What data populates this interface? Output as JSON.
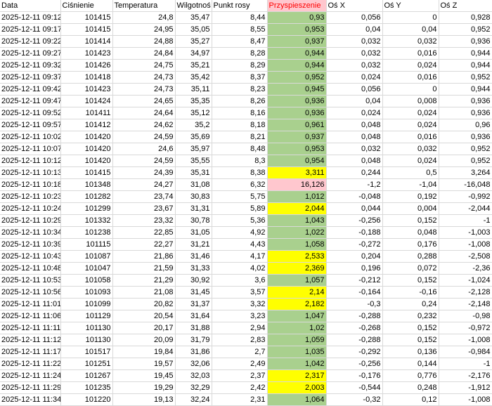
{
  "headers": [
    "Data",
    "Ciśnienie",
    "Temperatura",
    "Wilgotność",
    "Punkt rosy",
    "Przyspieszenie",
    "Oś X",
    "Oś Y",
    "Oś Z"
  ],
  "headers_display": [
    "Data",
    "Ciśnienie",
    "Temperatura",
    "Wilgotnoś",
    "Punkt rosy",
    "Przyspieszenie",
    "Oś X",
    "Oś Y",
    "Oś Z"
  ],
  "colors": {
    "green": "#a9d08e",
    "yellow": "#ffff00",
    "pink": "#ffc7ce",
    "header_accent": "#ff0000"
  },
  "rows": [
    {
      "cells": [
        "2025-12-11 09:12",
        "101415",
        "24,8",
        "35,47",
        "8,44",
        "0,93",
        "0,056",
        "0",
        "0,928"
      ],
      "hl": "green"
    },
    {
      "cells": [
        "2025-12-11 09:17",
        "101415",
        "24,95",
        "35,05",
        "8,55",
        "0,953",
        "0,04",
        "0,04",
        "0,952"
      ],
      "hl": "green"
    },
    {
      "cells": [
        "2025-12-11 09:22",
        "101414",
        "24,88",
        "35,27",
        "8,47",
        "0,937",
        "0,032",
        "0,032",
        "0,936"
      ],
      "hl": "green"
    },
    {
      "cells": [
        "2025-12-11 09:27",
        "101423",
        "24,84",
        "34,97",
        "8,28",
        "0,944",
        "0,032",
        "0,016",
        "0,944"
      ],
      "hl": "green"
    },
    {
      "cells": [
        "2025-12-11 09:32",
        "101426",
        "24,75",
        "35,21",
        "8,29",
        "0,944",
        "0,032",
        "0,024",
        "0,944"
      ],
      "hl": "green"
    },
    {
      "cells": [
        "2025-12-11 09:37",
        "101418",
        "24,73",
        "35,42",
        "8,37",
        "0,952",
        "0,024",
        "0,016",
        "0,952"
      ],
      "hl": "green"
    },
    {
      "cells": [
        "2025-12-11 09:42",
        "101423",
        "24,73",
        "35,11",
        "8,23",
        "0,945",
        "0,056",
        "0",
        "0,944"
      ],
      "hl": "green"
    },
    {
      "cells": [
        "2025-12-11 09:47",
        "101424",
        "24,65",
        "35,35",
        "8,26",
        "0,936",
        "0,04",
        "0,008",
        "0,936"
      ],
      "hl": "green"
    },
    {
      "cells": [
        "2025-12-11 09:52",
        "101411",
        "24,64",
        "35,12",
        "8,16",
        "0,936",
        "0,024",
        "0,024",
        "0,936"
      ],
      "hl": "green"
    },
    {
      "cells": [
        "2025-12-11 09:57",
        "101412",
        "24,62",
        "35,2",
        "8,18",
        "0,961",
        "0,048",
        "0,024",
        "0,96"
      ],
      "hl": "green"
    },
    {
      "cells": [
        "2025-12-11 10:02",
        "101420",
        "24,59",
        "35,69",
        "8,21",
        "0,937",
        "0,048",
        "0,016",
        "0,936"
      ],
      "hl": "green"
    },
    {
      "cells": [
        "2025-12-11 10:07",
        "101420",
        "24,6",
        "35,97",
        "8,48",
        "0,953",
        "0,032",
        "0,032",
        "0,952"
      ],
      "hl": "green"
    },
    {
      "cells": [
        "2025-12-11 10:12",
        "101420",
        "24,59",
        "35,55",
        "8,3",
        "0,954",
        "0,048",
        "0,024",
        "0,952"
      ],
      "hl": "green"
    },
    {
      "cells": [
        "2025-12-11 10:13",
        "101415",
        "24,39",
        "35,31",
        "8,38",
        "3,311",
        "0,244",
        "0,5",
        "3,264"
      ],
      "hl": "yellow"
    },
    {
      "cells": [
        "2025-12-11 10:18",
        "101348",
        "24,27",
        "31,08",
        "6,32",
        "16,126",
        "-1,2",
        "-1,04",
        "-16,048"
      ],
      "hl": "pink"
    },
    {
      "cells": [
        "2025-12-11 10:23",
        "101282",
        "23,74",
        "30,83",
        "5,75",
        "1,012",
        "-0,048",
        "0,192",
        "-0,992"
      ],
      "hl": "green"
    },
    {
      "cells": [
        "2025-12-11 10:24",
        "101299",
        "23,67",
        "31,31",
        "5,89",
        "2,044",
        "0,044",
        "0,004",
        "-2,044"
      ],
      "hl": "yellow"
    },
    {
      "cells": [
        "2025-12-11 10:29",
        "101332",
        "23,32",
        "30,78",
        "5,36",
        "1,043",
        "-0,256",
        "0,152",
        "-1"
      ],
      "hl": "green"
    },
    {
      "cells": [
        "2025-12-11 10:34",
        "101238",
        "22,85",
        "31,05",
        "4,92",
        "1,022",
        "-0,188",
        "0,048",
        "-1,003"
      ],
      "hl": "green"
    },
    {
      "cells": [
        "2025-12-11 10:39",
        "101115",
        "22,27",
        "31,21",
        "4,43",
        "1,058",
        "-0,272",
        "0,176",
        "-1,008"
      ],
      "hl": "green"
    },
    {
      "cells": [
        "2025-12-11 10:43",
        "101087",
        "21,86",
        "31,46",
        "4,17",
        "2,533",
        "0,204",
        "0,288",
        "-2,508"
      ],
      "hl": "yellow"
    },
    {
      "cells": [
        "2025-12-11 10:48",
        "101047",
        "21,59",
        "31,33",
        "4,02",
        "2,369",
        "0,196",
        "0,072",
        "-2,36"
      ],
      "hl": "yellow"
    },
    {
      "cells": [
        "2025-12-11 10:53",
        "101058",
        "21,29",
        "30,92",
        "3,6",
        "1,057",
        "-0,212",
        "0,152",
        "-1,024"
      ],
      "hl": "green"
    },
    {
      "cells": [
        "2025-12-11 10:56",
        "101093",
        "21,08",
        "31,45",
        "3,57",
        "2,14",
        "-0,164",
        "-0,16",
        "-2,128"
      ],
      "hl": "yellow"
    },
    {
      "cells": [
        "2025-12-11 11:01",
        "101099",
        "20,82",
        "31,37",
        "3,32",
        "2,182",
        "-0,3",
        "0,24",
        "-2,148"
      ],
      "hl": "yellow"
    },
    {
      "cells": [
        "2025-12-11 11:06",
        "101129",
        "20,54",
        "31,64",
        "3,23",
        "1,047",
        "-0,288",
        "0,232",
        "-0,98"
      ],
      "hl": "green"
    },
    {
      "cells": [
        "2025-12-11 11:11",
        "101130",
        "20,17",
        "31,88",
        "2,94",
        "1,02",
        "-0,268",
        "0,152",
        "-0,972"
      ],
      "hl": "green"
    },
    {
      "cells": [
        "2025-12-11 11:12",
        "101130",
        "20,09",
        "31,79",
        "2,83",
        "1,059",
        "-0,288",
        "0,152",
        "-1,008"
      ],
      "hl": "green"
    },
    {
      "cells": [
        "2025-12-11 11:17",
        "101517",
        "19,84",
        "31,86",
        "2,7",
        "1,035",
        "-0,292",
        "0,136",
        "-0,984"
      ],
      "hl": "green"
    },
    {
      "cells": [
        "2025-12-11 11:22",
        "101251",
        "19,57",
        "32,06",
        "2,49",
        "1,042",
        "-0,256",
        "0,144",
        "-1"
      ],
      "hl": "green"
    },
    {
      "cells": [
        "2025-12-11 11:24",
        "101267",
        "19,45",
        "32,03",
        "2,37",
        "2,317",
        "-0,176",
        "0,776",
        "-2,176"
      ],
      "hl": "yellow"
    },
    {
      "cells": [
        "2025-12-11 11:29",
        "101235",
        "19,29",
        "32,29",
        "2,42",
        "2,003",
        "-0,544",
        "0,248",
        "-1,912"
      ],
      "hl": "yellow"
    },
    {
      "cells": [
        "2025-12-11 11:34",
        "101220",
        "19,13",
        "32,24",
        "2,31",
        "1,064",
        "-0,32",
        "0,12",
        "-1,008"
      ],
      "hl": "green"
    }
  ]
}
